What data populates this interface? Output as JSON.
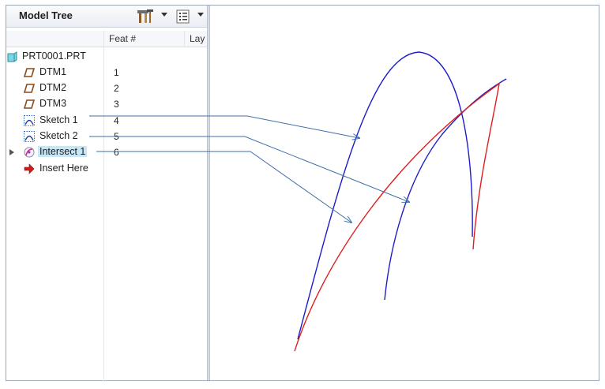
{
  "header": {
    "title": "Model Tree",
    "tools_icon": "tools-hammer-icon",
    "settings_icon": "tree-settings-icon"
  },
  "columns": {
    "feat": "Feat #",
    "layer": "Lay"
  },
  "tree": {
    "root": {
      "label": "PRT0001.PRT",
      "icon": "part-icon"
    },
    "items": [
      {
        "label": "DTM1",
        "feat": "1",
        "icon": "datum-plane-icon"
      },
      {
        "label": "DTM2",
        "feat": "2",
        "icon": "datum-plane-icon"
      },
      {
        "label": "DTM3",
        "feat": "3",
        "icon": "datum-plane-icon"
      },
      {
        "label": "Sketch 1",
        "feat": "4",
        "icon": "sketch-icon"
      },
      {
        "label": "Sketch 2",
        "feat": "5",
        "icon": "sketch-icon"
      },
      {
        "label": "Intersect 1",
        "feat": "6",
        "icon": "intersect-icon",
        "selected": true
      },
      {
        "label": "Insert Here",
        "feat": "",
        "icon": "insert-here-arrow-icon"
      }
    ]
  },
  "colors": {
    "sketch_curve": "#1c1ccc",
    "intersect_curve": "#e01e1e",
    "callout": "#3f6fa8",
    "selection": "#c7e6f6"
  }
}
